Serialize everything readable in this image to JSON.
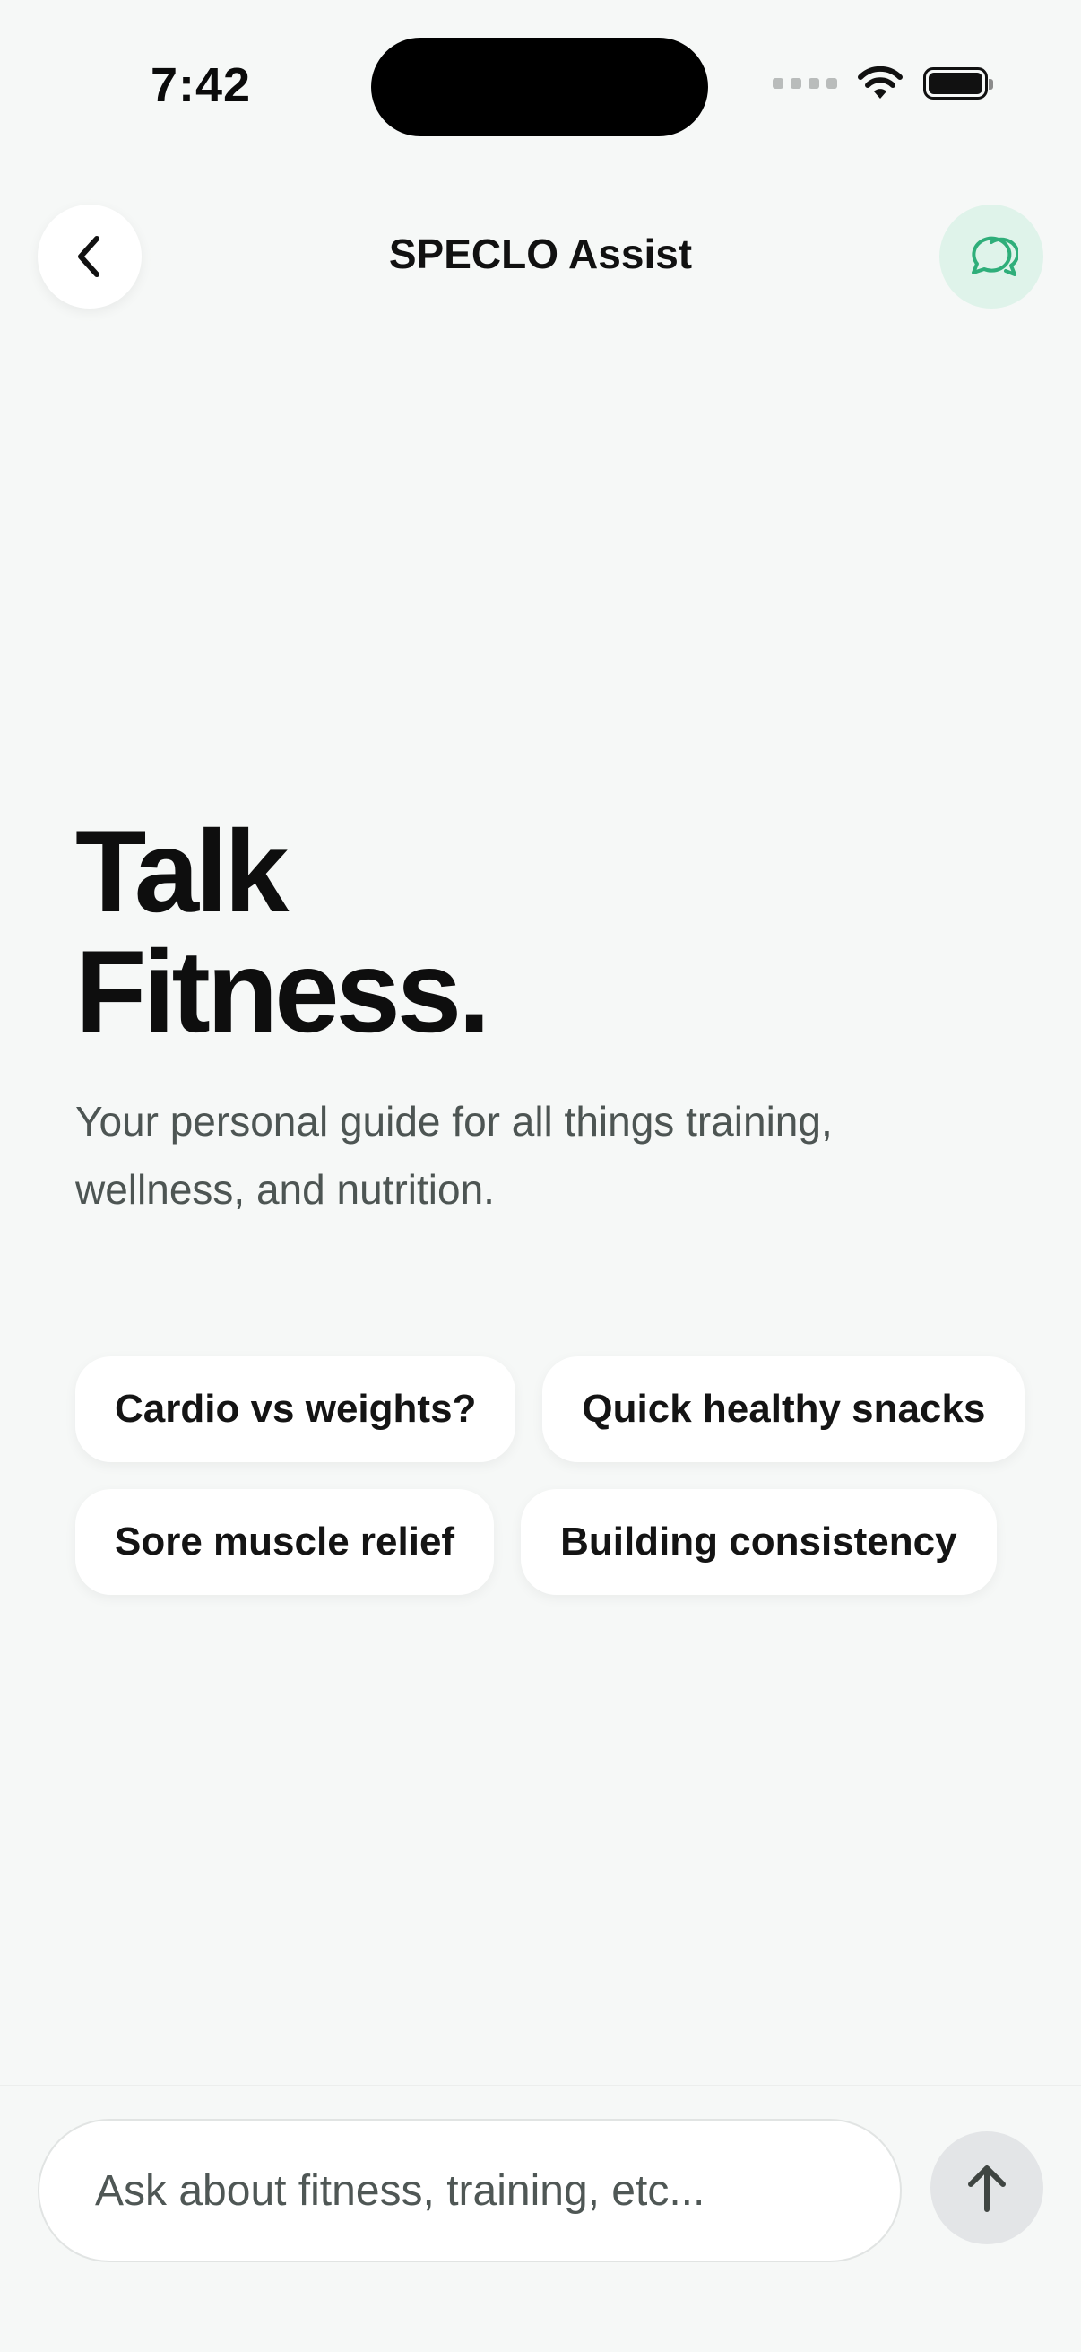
{
  "status_bar": {
    "time": "7:42"
  },
  "header": {
    "title": "SPECLO Assist",
    "back_icon": "chevron-left-icon",
    "chat_icon": "chat-bubbles-icon",
    "accent_color": "#2fae7a"
  },
  "hero": {
    "title_line1": "Talk",
    "title_line2": "Fitness.",
    "subtitle": "Your personal guide for all things training, wellness, and nutrition."
  },
  "suggestions": [
    {
      "label": "Cardio vs weights?"
    },
    {
      "label": "Quick healthy snacks"
    },
    {
      "label": "Sore muscle relief"
    },
    {
      "label": "Building consistency"
    }
  ],
  "composer": {
    "placeholder": "Ask about fitness, training, etc...",
    "value": "",
    "send_icon": "arrow-up-icon"
  }
}
